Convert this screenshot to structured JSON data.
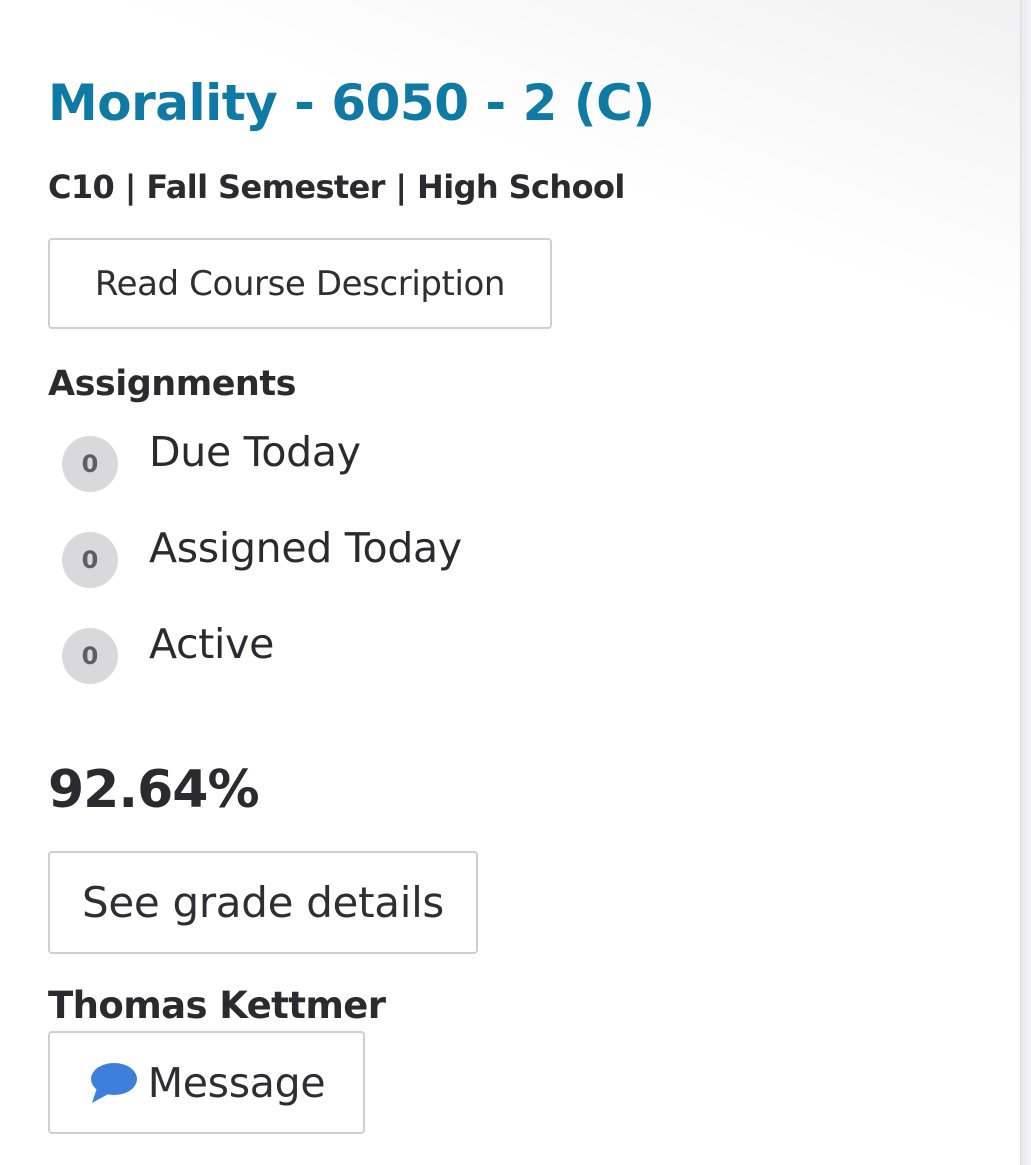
{
  "course": {
    "title": "Morality - 6050 - 2 (C)",
    "meta": "C10 | Fall Semester | High School",
    "description_button": "Read Course Description"
  },
  "assignments": {
    "heading": "Assignments",
    "items": [
      {
        "count": "0",
        "label": "Due Today"
      },
      {
        "count": "0",
        "label": "Assigned Today"
      },
      {
        "count": "0",
        "label": "Active"
      }
    ]
  },
  "grade": {
    "value": "92.64%",
    "details_button": "See grade details"
  },
  "teacher": {
    "name": "Thomas Kettmer",
    "message_button": "Message",
    "message_icon": "chat-bubble-icon"
  },
  "colors": {
    "title": "#0f7aa3",
    "text": "#2b2b2f",
    "badge": "#d9d9dc",
    "message_icon": "#3d7fdb"
  }
}
